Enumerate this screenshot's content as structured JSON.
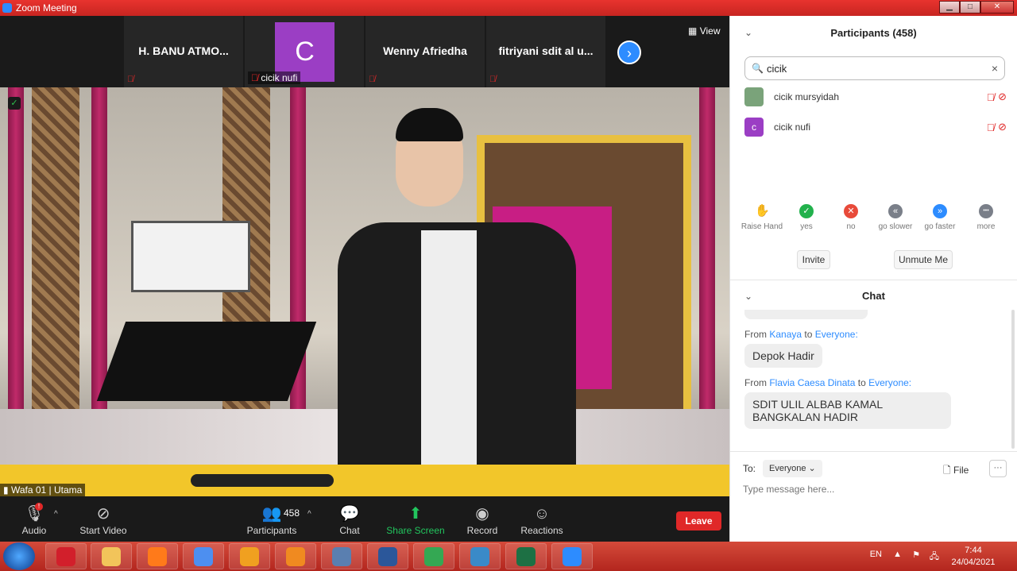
{
  "window": {
    "title": "Zoom Meeting",
    "minimize": "▁",
    "maximize": "□",
    "close": "✕"
  },
  "gallery": {
    "tiles": [
      {
        "name": "H. BANU ATMO..."
      },
      {
        "initial": "C",
        "label": "cicik nufi"
      },
      {
        "name": "Wenny Afriedha"
      },
      {
        "name": "fitriyani sdit al u..."
      }
    ],
    "view_label": "View"
  },
  "video": {
    "speaker_label": "Wafa 01 | Utama",
    "colors": {
      "pink": "#c81e84",
      "gold": "#e8c040",
      "banner": "#f2c62a"
    }
  },
  "toolbar": {
    "audio": "Audio",
    "start_video": "Start Video",
    "participants": "Participants",
    "participants_count": "458",
    "chat": "Chat",
    "share_screen": "Share Screen",
    "record": "Record",
    "reactions": "Reactions",
    "leave": "Leave"
  },
  "participants": {
    "title": "Participants (458)",
    "search_value": "cicik",
    "list": [
      {
        "name": "cicik mursyidah",
        "avatar_color": "#7aa37a",
        "initial": ""
      },
      {
        "name": "cicik nufi",
        "avatar_color": "#9b3ec4",
        "initial": "c"
      }
    ],
    "reactions": [
      {
        "label": "Raise Hand",
        "color": "#2d8cff",
        "glyph": "✋"
      },
      {
        "label": "yes",
        "color": "#22b14c",
        "glyph": "✓"
      },
      {
        "label": "no",
        "color": "#e84a3a",
        "glyph": "✕"
      },
      {
        "label": "go slower",
        "color": "#7a7f89",
        "glyph": "«"
      },
      {
        "label": "go faster",
        "color": "#2d8cff",
        "glyph": "»"
      },
      {
        "label": "more",
        "color": "#7a7f89",
        "glyph": "•••"
      }
    ],
    "invite": "Invite",
    "unmute_me": "Unmute Me"
  },
  "chat": {
    "title": "Chat",
    "from_word": "From",
    "to_word": "to",
    "messages": [
      {
        "from": "Kanaya",
        "to": "Everyone:",
        "text": "Depok Hadir"
      },
      {
        "from": "Flavia Caesa Dinata",
        "to": "Everyone:",
        "text": "SDIT ULIL ALBAB KAMAL BANGKALAN HADIR"
      }
    ],
    "to_label": "To:",
    "recipient": "Everyone",
    "file_label": "File",
    "placeholder": "Type message here..."
  },
  "taskbar": {
    "language": "EN",
    "time": "7:44",
    "date": "24/04/2021",
    "apps": [
      {
        "name": "opera-icon",
        "color": "#d21f2b"
      },
      {
        "name": "file-explorer-icon",
        "color": "#f2c45a"
      },
      {
        "name": "firefox-icon",
        "color": "#ff7a1a"
      },
      {
        "name": "chromium-icon",
        "color": "#4d8ff0"
      },
      {
        "name": "uc-browser-icon",
        "color": "#f0a020"
      },
      {
        "name": "media-player-icon",
        "color": "#f08a20"
      },
      {
        "name": "network-icon",
        "color": "#5a7fb0"
      },
      {
        "name": "word-icon",
        "color": "#2b579a"
      },
      {
        "name": "chrome-icon",
        "color": "#34a853"
      },
      {
        "name": "photos-icon",
        "color": "#3a8ac8"
      },
      {
        "name": "excel-icon",
        "color": "#1d7044"
      },
      {
        "name": "zoom-icon",
        "color": "#2d8cff"
      }
    ]
  }
}
